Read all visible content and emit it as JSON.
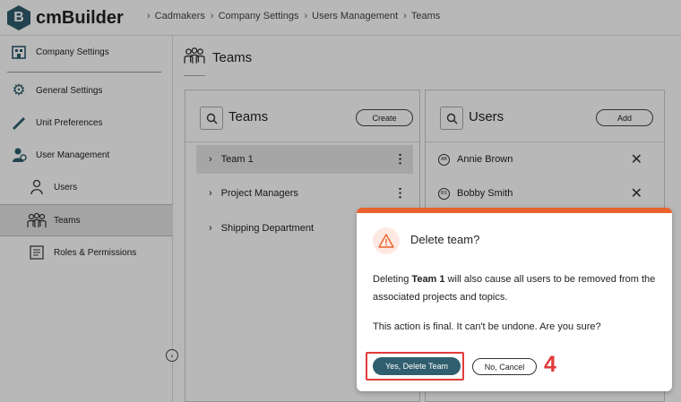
{
  "app": {
    "logo_letter": "B",
    "name": "cmBuilder"
  },
  "breadcrumb": [
    "Cadmakers",
    "Company Settings",
    "Users Management",
    "Teams"
  ],
  "sidebar": {
    "items": [
      {
        "label": "Company Settings",
        "icon": "building-icon"
      },
      {
        "label": "General Settings",
        "icon": "gear-icon"
      },
      {
        "label": "Unit Preferences",
        "icon": "ruler-icon"
      },
      {
        "label": "User Management",
        "icon": "user-management-icon"
      },
      {
        "label": "Users",
        "icon": "user-icon"
      },
      {
        "label": "Teams",
        "icon": "team-icon"
      },
      {
        "label": "Roles & Permissions",
        "icon": "roles-icon"
      }
    ]
  },
  "page": {
    "title": "Teams"
  },
  "teams_panel": {
    "title": "Teams",
    "create_label": "Create",
    "rows": [
      "Team 1",
      "Project Managers",
      "Shipping Department"
    ]
  },
  "users_panel": {
    "title": "Users",
    "add_label": "Add",
    "rows": [
      {
        "initials": "AB",
        "name": "Annie Brown"
      },
      {
        "initials": "BS",
        "name": "Bobby Smith"
      }
    ]
  },
  "dialog": {
    "title": "Delete team?",
    "body_prefix": "Deleting ",
    "body_team": "Team 1",
    "body_suffix": " will also cause all users to be removed from the associated projects and topics.",
    "confirm": "This action is final. It can't be undone. Are you sure?",
    "yes_label": "Yes, Delete Team",
    "no_label": "No, Cancel"
  },
  "annotation": {
    "step": "4"
  },
  "colors": {
    "accent": "#2f5e6e",
    "warning": "#e8632d",
    "highlight": "#e23b3b"
  }
}
